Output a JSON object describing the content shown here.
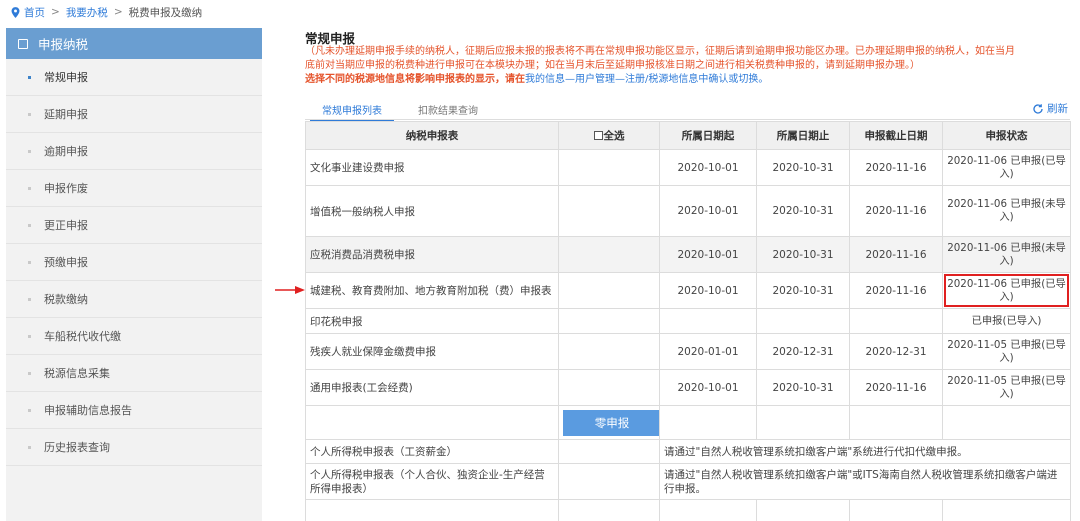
{
  "breadcrumb": {
    "home": "首页",
    "sep": ">",
    "level2": "我要办税",
    "current": "税费申报及缴纳"
  },
  "sidebar": {
    "header": "申报纳税",
    "items": [
      {
        "label": "常规申报"
      },
      {
        "label": "延期申报"
      },
      {
        "label": "逾期申报"
      },
      {
        "label": "申报作废"
      },
      {
        "label": "更正申报"
      },
      {
        "label": "预缴申报"
      },
      {
        "label": "税款缴纳"
      },
      {
        "label": "车船税代收代缴"
      },
      {
        "label": "税源信息采集"
      },
      {
        "label": "申报辅助信息报告"
      },
      {
        "label": "历史报表查询"
      }
    ]
  },
  "main": {
    "title": "常规申报",
    "notice_line1": "（凡未办理延期申报手续的纳税人，征期后应报未报的报表将不再在常规申报功能区显示，征期后请到逾期申报功能区办理。已办理延期申报的纳税人，如在当月",
    "notice_line2": "底前对当期应申报的税费种进行申报可在本模块办理；如在当月末后至延期申报核准日期之间进行相关税费种申报的，请到延期申报办理。）",
    "notice_bold_prefix": "选择不同的税源地信息将影响申报表的显示，请在",
    "notice_link": "我的信息—用户管理—注册/税源地信息中确认或切换。"
  },
  "tabs": {
    "tab1": "常规申报列表",
    "tab2": "扣款结果查询",
    "refresh": "刷新"
  },
  "table": {
    "headers": {
      "name": "纳税申报表",
      "select_all": "全选",
      "start": "所属日期起",
      "end": "所属日期止",
      "deadline": "申报截止日期",
      "status": "申报状态"
    },
    "rows": [
      {
        "name": "文化事业建设费申报",
        "start": "2020-10-01",
        "end": "2020-10-31",
        "deadline": "2020-11-16",
        "status": "2020-11-06 已申报(已导入)"
      },
      {
        "name": "增值税一般纳税人申报",
        "start": "2020-10-01",
        "end": "2020-10-31",
        "deadline": "2020-11-16",
        "status": "2020-11-06 已申报(未导入)"
      },
      {
        "name": "应税消费品消费税申报",
        "start": "2020-10-01",
        "end": "2020-10-31",
        "deadline": "2020-11-16",
        "status": "2020-11-06 已申报(未导入)"
      },
      {
        "name": "城建税、教育费附加、地方教育附加税（费）申报表",
        "start": "2020-10-01",
        "end": "2020-10-31",
        "deadline": "2020-11-16",
        "status": "2020-11-06 已申报(已导入)"
      },
      {
        "name": "印花税申报",
        "start": "",
        "end": "",
        "deadline": "",
        "status": "已申报(已导入)"
      },
      {
        "name": "残疾人就业保障金缴费申报",
        "start": "2020-01-01",
        "end": "2020-12-31",
        "deadline": "2020-12-31",
        "status": "2020-11-05 已申报(已导入)"
      },
      {
        "name": "通用申报表(工会经费)",
        "start": "2020-10-01",
        "end": "2020-10-31",
        "deadline": "2020-11-16",
        "status": "2020-11-05 已申报(已导入)"
      }
    ],
    "zero_button": "零申报",
    "personal_rows": [
      {
        "name": "个人所得税申报表（工资薪金）",
        "note": "请通过\"自然人税收管理系统扣缴客户端\"系统进行代扣代缴申报。"
      },
      {
        "name": "个人所得税申报表（个人合伙、独资企业-生产经营所得申报表）",
        "note": "请通过\"自然人税收管理系统扣缴客户端\"或ITS海南自然人税收管理系统扣缴客户端进行申报。"
      }
    ]
  },
  "colors": {
    "accent": "#2f7bd8",
    "sidebar_header": "#6a9ed1",
    "notice": "#e5542c",
    "highlight": "#e02020",
    "zero_button": "#5a9be0"
  }
}
